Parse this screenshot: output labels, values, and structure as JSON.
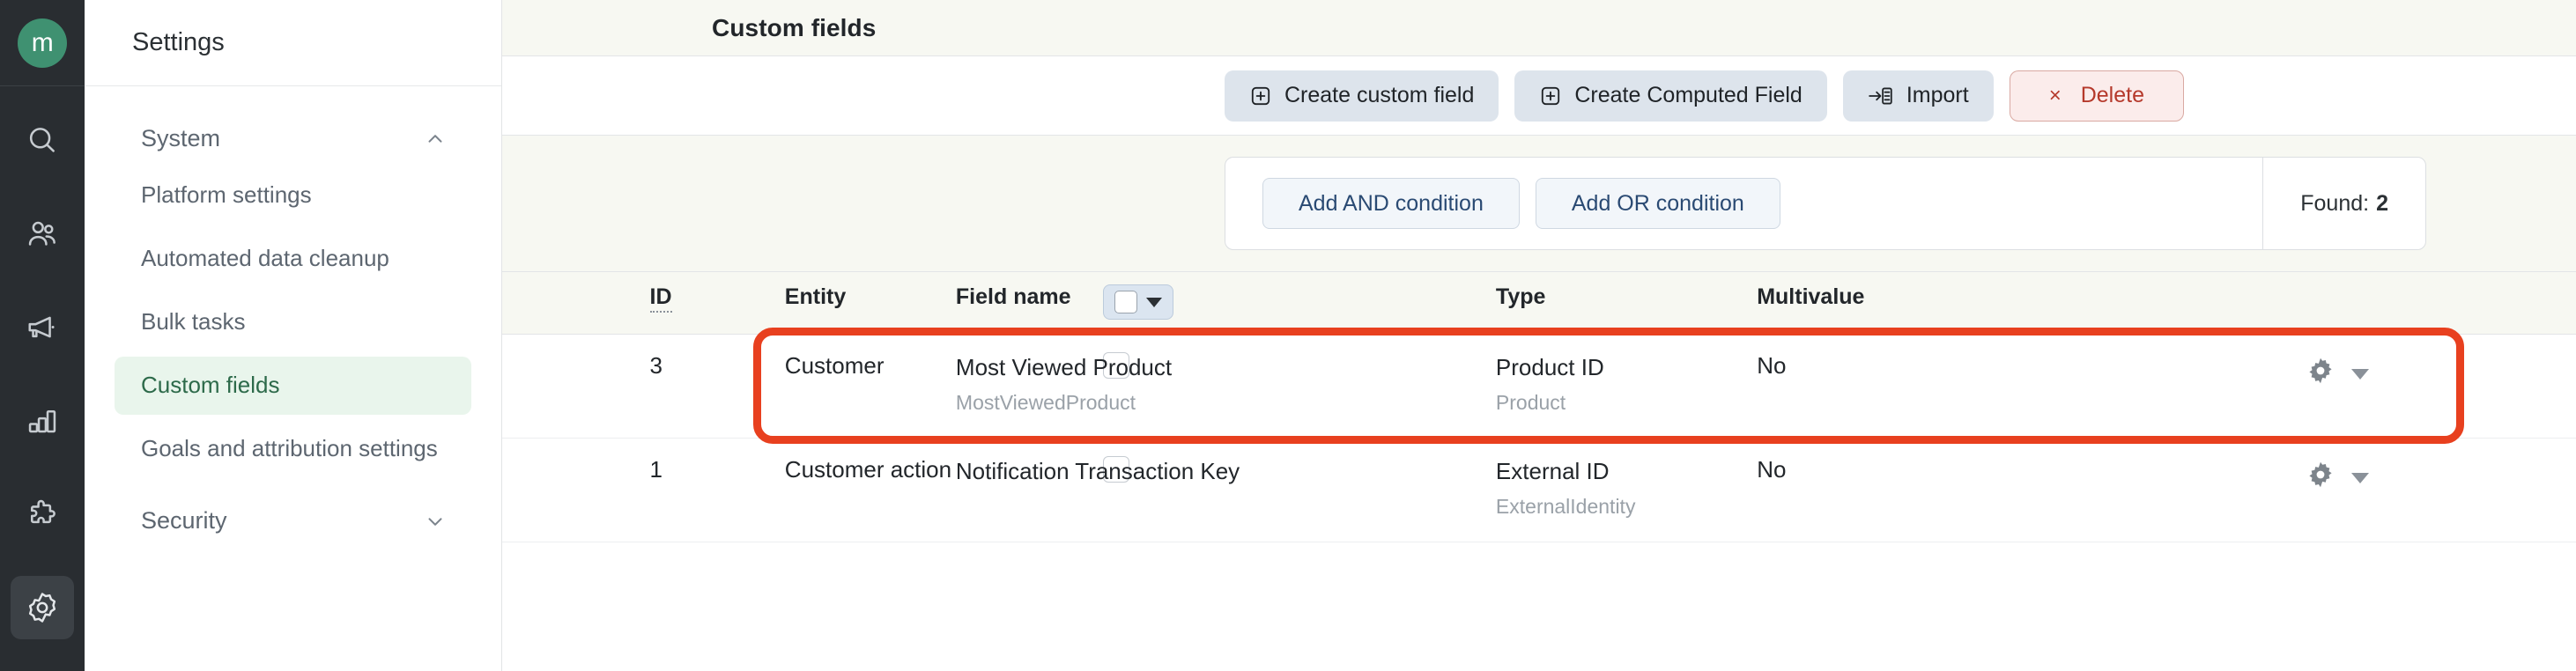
{
  "brand": {
    "logo_letter": "m",
    "logo_color": "#3f9171",
    "rail_background": "#292d31"
  },
  "rail": {
    "items": [
      {
        "icon": "search-icon",
        "name": "search",
        "active": false
      },
      {
        "icon": "contacts-icon",
        "name": "contacts",
        "active": false
      },
      {
        "icon": "megaphone-icon",
        "name": "campaigns",
        "active": false
      },
      {
        "icon": "bar-chart-icon",
        "name": "analytics",
        "active": false
      },
      {
        "icon": "puzzle-piece-icon",
        "name": "integrations",
        "active": false
      },
      {
        "icon": "gear-icon",
        "name": "settings",
        "active": true
      }
    ]
  },
  "nav": {
    "header_title": "Settings",
    "groups": [
      {
        "label": "System",
        "expanded": true,
        "chevron": "chevron-up-icon",
        "items": [
          {
            "label": "Platform settings",
            "selected": false
          },
          {
            "label": "Automated data cleanup",
            "selected": false
          },
          {
            "label": "Bulk tasks",
            "selected": false
          },
          {
            "label": "Custom fields",
            "selected": true
          },
          {
            "label": "Goals and attribution settings",
            "selected": false
          }
        ]
      },
      {
        "label": "Security",
        "expanded": false,
        "chevron": "chevron-down-icon",
        "items": []
      }
    ],
    "selected_color": "#2d6a4a",
    "selected_background": "#e9f5ec"
  },
  "page": {
    "title": "Custom fields"
  },
  "toolbar": {
    "create_custom_field": "Create custom field",
    "create_computed_field": "Create Computed Field",
    "import": "Import",
    "delete": "Delete",
    "delete_x": "×",
    "delete_color": "#b5392b"
  },
  "filter": {
    "add_and_condition": "Add AND condition",
    "add_or_condition": "Add OR condition",
    "found_label": "Found:",
    "found_count": "2"
  },
  "table": {
    "columns": [
      {
        "key": "check",
        "label": ""
      },
      {
        "key": "id",
        "label": "ID",
        "sortable": true
      },
      {
        "key": "entity",
        "label": "Entity"
      },
      {
        "key": "fieldname",
        "label": "Field name"
      },
      {
        "key": "type",
        "label": "Type"
      },
      {
        "key": "multivalue",
        "label": "Multivalue"
      },
      {
        "key": "actions",
        "label": ""
      }
    ],
    "rows": [
      {
        "id": "3",
        "entity": "Customer",
        "field_name": "Most Viewed Product",
        "field_code": "MostViewedProduct",
        "type": "Product ID",
        "type_code": "Product",
        "multivalue": "No",
        "checked": false,
        "highlighted": true
      },
      {
        "id": "1",
        "entity": "Customer action",
        "field_name": "Notification Transaction Key",
        "field_code": "",
        "type": "External ID",
        "type_code": "ExternalIdentity",
        "multivalue": "No",
        "checked": false,
        "highlighted": false
      }
    ],
    "row_action_icon": "gear-icon",
    "row_action_caret": "chevron-down-icon"
  },
  "annotation": {
    "color": "#e8401f",
    "target_row_index": 0
  }
}
